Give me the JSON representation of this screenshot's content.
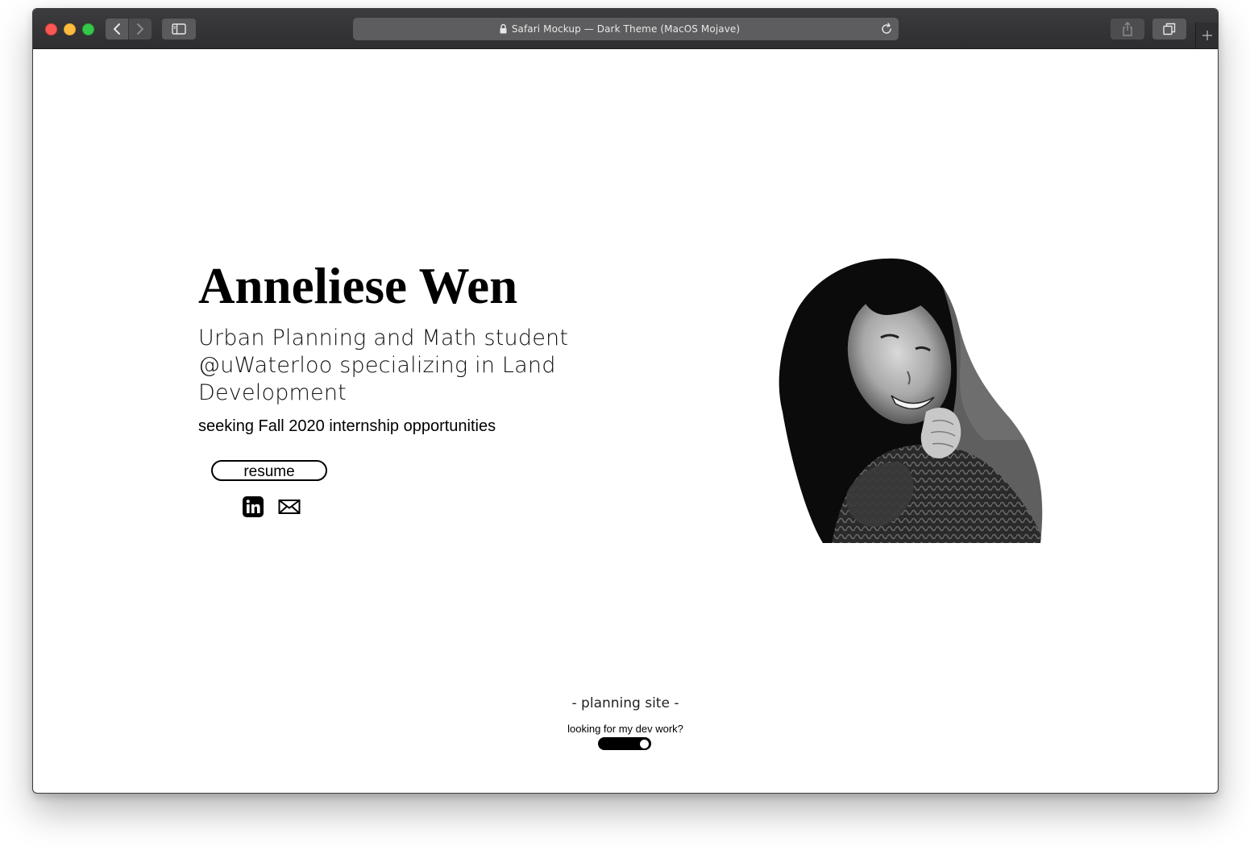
{
  "browser": {
    "url_title": "Safari Mockup — Dark Theme (MacOS Mojave)",
    "icons": [
      "close-light",
      "minimize-light",
      "zoom-light",
      "chevron-left-icon",
      "chevron-right-icon",
      "sidebar-icon",
      "lock-icon",
      "reload-icon",
      "share-icon",
      "tabs-icon",
      "plus-icon"
    ]
  },
  "hero": {
    "name": "Anneliese Wen",
    "tagline": "Urban Planning and Math student @uWaterloo specializing in Land Development",
    "seeking": "seeking Fall 2020 internship opportunities",
    "resume_label": "resume",
    "social": [
      "linkedin-icon",
      "mail-icon"
    ]
  },
  "footer": {
    "site_label": "- planning site -",
    "dev_question": "looking for my dev work?",
    "toggle_on": true
  },
  "colors": {
    "titlebar": "#2e2e30",
    "close": "#fc5753",
    "minimize": "#fdbc40",
    "zoom": "#34c749",
    "page_bg": "#ffffff",
    "text": "#000000"
  }
}
